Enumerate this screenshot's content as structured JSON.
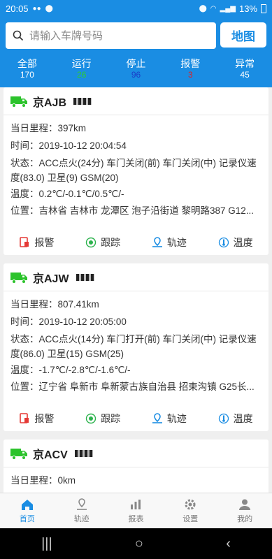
{
  "status_bar": {
    "time": "20:05",
    "battery": "13%"
  },
  "search": {
    "placeholder": "请输入车牌号码",
    "map_label": "地图"
  },
  "tabs": [
    {
      "label": "全部",
      "count": "170",
      "color": "#ffffff"
    },
    {
      "label": "运行",
      "count": "26",
      "color": "#2ecc2e"
    },
    {
      "label": "停止",
      "count": "96",
      "color": "#1a3fc8"
    },
    {
      "label": "报警",
      "count": "3",
      "color": "#e02020"
    },
    {
      "label": "异常",
      "count": "45",
      "color": "#ffffff"
    }
  ],
  "vehicles": [
    {
      "plate": "京AJB",
      "mileage_label": "当日里程：",
      "mileage": "397km",
      "time_label": "时间：",
      "time": "2019-10-12 20:04:54",
      "status_label": "状态：",
      "status": "ACC点火(24分) 车门关闭(前) 车门关闭(中) 记录仪速度(83.0) 卫星(9) GSM(20)",
      "temp_label": "温度：",
      "temp": "0.2℃/-0.1℃/0.5℃/-",
      "location_label": "位置：",
      "location": "吉林省 吉林市 龙潭区 泡子沿街道 黎明路387 G12..."
    },
    {
      "plate": "京AJW",
      "mileage_label": "当日里程：",
      "mileage": "807.41km",
      "time_label": "时间：",
      "time": "2019-10-12 20:05:00",
      "status_label": "状态：",
      "status": "ACC点火(14分) 车门打开(前) 车门关闭(中) 记录仪速度(86.0) 卫星(15) GSM(25)",
      "temp_label": "温度：",
      "temp": "-1.7℃/-2.8℃/-1.6℃/-",
      "location_label": "位置：",
      "location": "辽宁省 阜新市 阜新蒙古族自治县 招束沟镇 G25长..."
    },
    {
      "plate": "京ACV",
      "mileage_label": "当日里程：",
      "mileage": "0km"
    }
  ],
  "actions": [
    "报警",
    "跟踪",
    "轨迹",
    "温度"
  ],
  "bottom_nav": [
    "首页",
    "轨迹",
    "报表",
    "设置",
    "我的"
  ],
  "colors": {
    "primary": "#1a8de3",
    "truck": "#2cc32c",
    "alarm": "#e53935"
  }
}
